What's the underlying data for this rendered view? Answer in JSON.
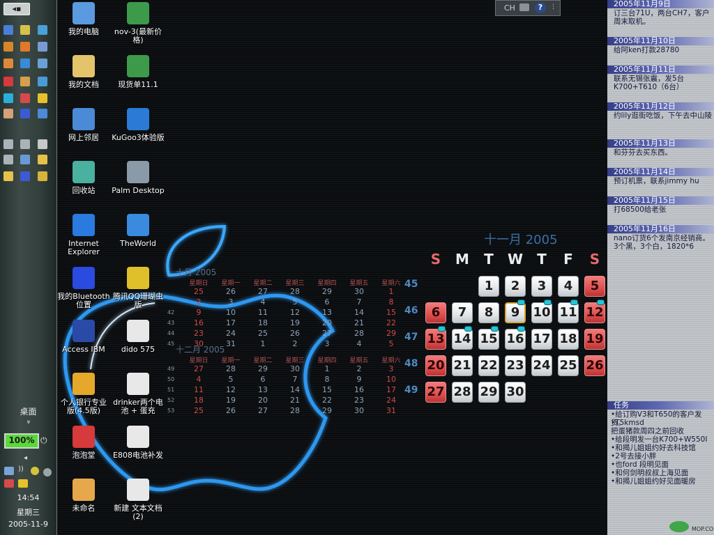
{
  "sidebar": {
    "top_button": "◂▪",
    "desktop_label": "桌面",
    "chevron": "»",
    "battery_percent": 100,
    "battery_label": "100%",
    "collapse_arrow": "◂",
    "time": "14:54",
    "weekday": "星期三",
    "date": "2005-11-9",
    "icon_colors": [
      "#4a7fd6",
      "#d6c24a",
      "#4aa0d6",
      "#d6862a",
      "#e07a2a",
      "#7a9ad6",
      "#e0883a",
      "#3a8ad6",
      "#6aa0d6",
      "#d63a3a",
      "#d6a04a",
      "#4a9ad6",
      "#2ab0d6",
      "#d64a4a",
      "#e6c22a",
      "#d6a07a",
      "#3a5ad6",
      "#4a8ad6",
      "#aab4b8",
      "#aab4b8",
      "#c8c8c8",
      "#aab4b8",
      "#6a9ad6",
      "#e6c24a",
      "#e6c24a",
      "#3a5ad6",
      "#d6b43a"
    ]
  },
  "desktop_icons": [
    {
      "label": "我的电脑",
      "icon": "my-computer-icon",
      "color": "#5a9ae0"
    },
    {
      "label": "nov-3(最新价格)",
      "icon": "excel-icon",
      "color": "#3d9a4a"
    },
    {
      "label": "我的文档",
      "icon": "my-documents-icon",
      "color": "#e3c46a"
    },
    {
      "label": "现货单11.1",
      "icon": "excel-icon",
      "color": "#3d9a4a"
    },
    {
      "label": "网上邻居",
      "icon": "network-places-icon",
      "color": "#4a8ad6"
    },
    {
      "label": "KuGoo3体验版",
      "icon": "kugoo-icon",
      "color": "#2a7ad6"
    },
    {
      "label": "回收站",
      "icon": "recycle-bin-icon",
      "color": "#4ab0a0"
    },
    {
      "label": "Palm Desktop",
      "icon": "palm-desktop-icon",
      "color": "#8a9aa8"
    },
    {
      "label": "Internet Explorer",
      "icon": "internet-explorer-icon",
      "color": "#2a7ae0"
    },
    {
      "label": "TheWorld",
      "icon": "theworld-icon",
      "color": "#3a8ae0"
    },
    {
      "label": "我的Bluetooth位置",
      "icon": "bluetooth-icon",
      "color": "#2a4ae0"
    },
    {
      "label": "腾讯QQ珊瑚虫版",
      "icon": "qq-penguin-icon",
      "color": "#e0c02a"
    },
    {
      "label": "Access IBM",
      "icon": "ibm-icon",
      "color": "#2a4aa8"
    },
    {
      "label": "dido 575",
      "icon": "text-document-icon",
      "color": "#e8e8e8"
    },
    {
      "label": "个人银行专业版(4.5版)",
      "icon": "bank-sun-icon",
      "color": "#e6a82a"
    },
    {
      "label": "drinker两个电池 + 蛋充",
      "icon": "text-document-icon",
      "color": "#e8e8e8"
    },
    {
      "label": "泡泡堂",
      "icon": "joystick-icon",
      "color": "#d63a3a"
    },
    {
      "label": "E808电池补发",
      "icon": "text-document-icon",
      "color": "#e8e8e8"
    },
    {
      "label": "未命名",
      "icon": "jpg-image-icon",
      "color": "#e6a84a"
    },
    {
      "label": "新建 文本文档 (2)",
      "icon": "text-document-icon",
      "color": "#e8e8e8"
    }
  ],
  "language_bar": {
    "lang": "CH",
    "help": "?"
  },
  "small_calendars": [
    {
      "title": "十月 2005",
      "headers": [
        "星期日",
        "星期一",
        "星期二",
        "星期三",
        "星期四",
        "星期五",
        "星期六"
      ],
      "weeks": [
        {
          "wk": "",
          "days": [
            "25",
            "26",
            "27",
            "28",
            "29",
            "30",
            "1"
          ]
        },
        {
          "wk": "",
          "days": [
            "2",
            "3",
            "4",
            "5",
            "6",
            "7",
            "8"
          ]
        },
        {
          "wk": "42",
          "days": [
            "9",
            "10",
            "11",
            "12",
            "13",
            "14",
            "15"
          ]
        },
        {
          "wk": "43",
          "days": [
            "16",
            "17",
            "18",
            "19",
            "20",
            "21",
            "22"
          ]
        },
        {
          "wk": "44",
          "days": [
            "23",
            "24",
            "25",
            "26",
            "27",
            "28",
            "29"
          ]
        },
        {
          "wk": "45",
          "days": [
            "30",
            "31",
            "1",
            "2",
            "3",
            "4",
            "5"
          ]
        }
      ]
    },
    {
      "title": "十二月 2005",
      "headers": [
        "星期日",
        "星期一",
        "星期二",
        "星期三",
        "星期四",
        "星期五",
        "星期六"
      ],
      "weeks": [
        {
          "wk": "49",
          "days": [
            "27",
            "28",
            "29",
            "30",
            "1",
            "2",
            "3"
          ]
        },
        {
          "wk": "50",
          "days": [
            "4",
            "5",
            "6",
            "7",
            "8",
            "9",
            "10"
          ]
        },
        {
          "wk": "51",
          "days": [
            "11",
            "12",
            "13",
            "14",
            "15",
            "16",
            "17"
          ]
        },
        {
          "wk": "52",
          "days": [
            "18",
            "19",
            "20",
            "21",
            "22",
            "23",
            "24"
          ]
        },
        {
          "wk": "53",
          "days": [
            "25",
            "26",
            "27",
            "28",
            "29",
            "30",
            "31"
          ]
        }
      ]
    }
  ],
  "big_calendar": {
    "title": "十一月 2005",
    "headers": [
      "S",
      "M",
      "T",
      "W",
      "T",
      "F",
      "S"
    ],
    "weeks": [
      {
        "wk": "45",
        "days": [
          "",
          "",
          "1",
          "2",
          "3",
          "4",
          "5"
        ]
      },
      {
        "wk": "46",
        "days": [
          "6",
          "7",
          "8",
          "9",
          "10",
          "11",
          "12"
        ]
      },
      {
        "wk": "47",
        "days": [
          "13",
          "14",
          "15",
          "16",
          "17",
          "18",
          "19"
        ]
      },
      {
        "wk": "48",
        "days": [
          "20",
          "21",
          "22",
          "23",
          "24",
          "25",
          "26"
        ]
      },
      {
        "wk": "49",
        "days": [
          "27",
          "28",
          "29",
          "30",
          "",
          "",
          ""
        ]
      }
    ],
    "today": "9",
    "days_with_notes": [
      "9",
      "10",
      "11",
      "12",
      "13",
      "14",
      "15",
      "16"
    ]
  },
  "notes": [
    {
      "date": "2005年11月9日",
      "text": "订三台71U，两台CH7，客户周末取机。"
    },
    {
      "date": "2005年11月10日",
      "text": "给阿ken打款28780"
    },
    {
      "date": "2005年11月11日",
      "text": "联系无锡张震，发5台K700+T610（6台）"
    },
    {
      "date": "2005年11月12日",
      "text": "约lily逛街吃饭，下午去中山陵"
    },
    {
      "date": "2005年11月13日",
      "text": "和芬芬去买东西。"
    },
    {
      "date": "2005年11月14日",
      "text": "预订机票，联系jimmy hu"
    },
    {
      "date": "2005年11月15日",
      "text": "打68500给老张"
    },
    {
      "date": "2005年11月16日",
      "text": "nano订货6个发南京经销商。3个黑，3个白，1820*6"
    }
  ],
  "tasks": {
    "header": "任务",
    "items": [
      "•给订购V3和T650的客户发货。",
      "•T5kmsd",
      "  把蛋猪款周四之前回收",
      "•给段明发一台K700+W550I",
      "•和揭儿姐姐约好去科技馆",
      "•2号去接小胖",
      "•也ford 段明见面",
      "•和何剑明叔叔上海见面",
      "•和揭儿姐姐约好见面暖房"
    ]
  },
  "watermark": "MOP.COM"
}
